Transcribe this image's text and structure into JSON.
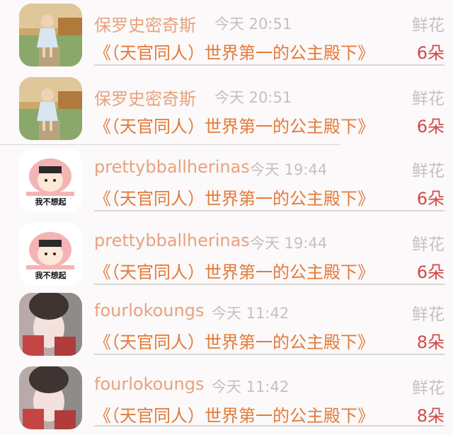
{
  "rows": [
    {
      "user": "保罗史密奇斯",
      "time": "今天 20:51",
      "gift": "鲜花",
      "work": "《（天官同人）世界第一的公主殿下》",
      "count": "6朵",
      "avatar_icon": "girl-photo-avatar"
    },
    {
      "user": "保罗史密奇斯",
      "time": "今天 20:51",
      "gift": "鲜花",
      "work": "《（天官同人）世界第一的公主殿下》",
      "count": "6朵",
      "avatar_icon": "girl-photo-avatar"
    },
    {
      "user": "prettybballherinas",
      "time": "今天 19:44",
      "gift": "鲜花",
      "work": "《（天官同人）世界第一的公主殿下》",
      "count": "6朵",
      "avatar_icon": "cartoon-avatar",
      "avatar_caption": "我不想起"
    },
    {
      "user": "prettybballherinas",
      "time": "今天 19:44",
      "gift": "鲜花",
      "work": "《（天官同人）世界第一的公主殿下》",
      "count": "6朵",
      "avatar_icon": "cartoon-avatar",
      "avatar_caption": "我不想起"
    },
    {
      "user": "fourlokoungs",
      "time": "今天 11:42",
      "gift": "鲜花",
      "work": "《（天官同人）世界第一的公主殿下》",
      "count": "8朵",
      "avatar_icon": "photo-avatar"
    },
    {
      "user": "fourlokoungs",
      "time": "今天 11:42",
      "gift": "鲜花",
      "work": "《（天官同人）世界第一的公主殿下》",
      "count": "8朵",
      "avatar_icon": "photo-avatar"
    }
  ],
  "colors": {
    "name": "#e8a27e",
    "work": "#e37a3a",
    "count": "#d24a4a",
    "muted": "#c4c0c0"
  }
}
